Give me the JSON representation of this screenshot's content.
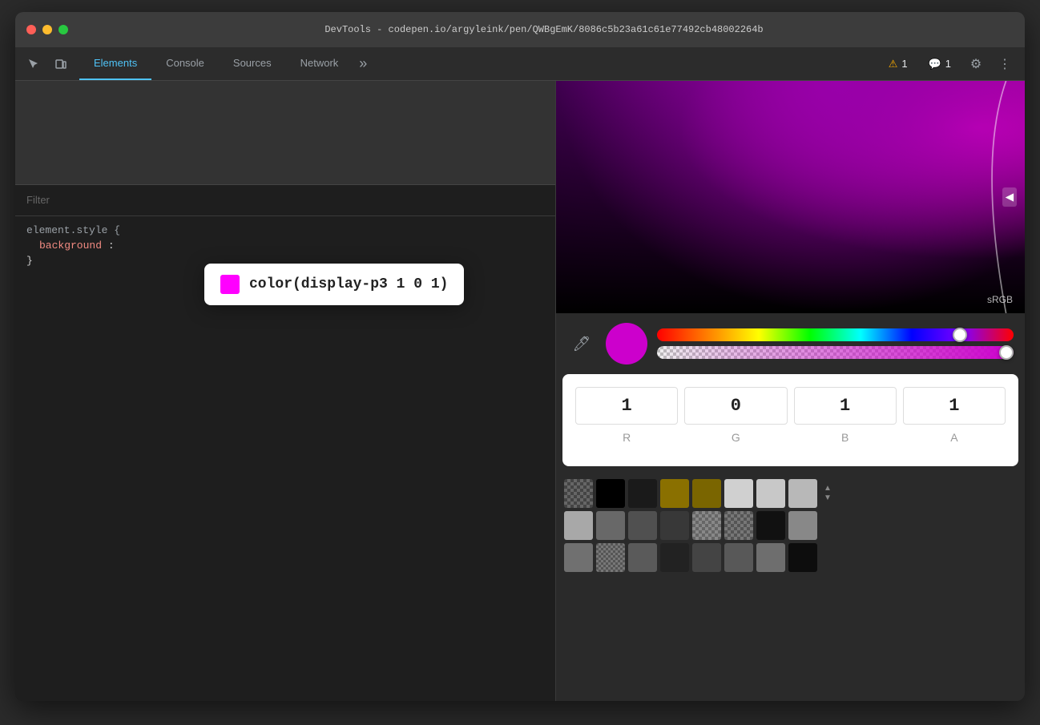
{
  "window": {
    "title": "DevTools - codepen.io/argyleink/pen/QWBgEmK/8086c5b23a61c61e77492cb48002264b"
  },
  "tabs": [
    {
      "label": "Elements",
      "active": true
    },
    {
      "label": "Console",
      "active": false
    },
    {
      "label": "Sources",
      "active": false
    },
    {
      "label": "Network",
      "active": false
    }
  ],
  "toolbar": {
    "more_icon": "»",
    "warn_count": "1",
    "info_count": "1",
    "settings_icon": "⚙",
    "more_vert_icon": "⋮"
  },
  "filter": {
    "placeholder": "Filter",
    "label": "Filter"
  },
  "styles": {
    "rule_selector": "element.style {",
    "prop_name": "background",
    "prop_value": "color(display-p3 1 0 1);",
    "close_brace": "}"
  },
  "tooltip": {
    "color_hex": "#ff00ff",
    "text": "color(display-p3 1 0 1)"
  },
  "color_picker": {
    "srgb_label": "sRGB",
    "channel_r": "1",
    "channel_g": "0",
    "channel_b": "1",
    "channel_a": "1",
    "label_r": "R",
    "label_g": "G",
    "label_b": "B",
    "label_a": "A"
  },
  "swatches": {
    "row1": [
      {
        "bg": "repeating-conic-gradient(#666 0% 25%, #444 0% 50%) 0 0/8px 8px",
        "type": "checker"
      },
      {
        "bg": "#000000",
        "type": "solid"
      },
      {
        "bg": "#1a1a1a",
        "type": "solid"
      },
      {
        "bg": "#8a7000",
        "type": "solid"
      },
      {
        "bg": "#7a6500",
        "type": "solid"
      },
      {
        "bg": "#d0d0d0",
        "type": "solid"
      },
      {
        "bg": "#c8c8c8",
        "type": "solid"
      },
      {
        "bg": "#b8b8b8",
        "type": "solid"
      }
    ],
    "row2": [
      {
        "bg": "#a8a8a8",
        "type": "solid"
      },
      {
        "bg": "#686868",
        "type": "solid"
      },
      {
        "bg": "#505050",
        "type": "solid"
      },
      {
        "bg": "#383838",
        "type": "solid"
      },
      {
        "bg": "repeating-conic-gradient(#888 0% 25%, #666 0% 50%) 0 0/8px 8px",
        "type": "checker"
      },
      {
        "bg": "repeating-conic-gradient(#777 0% 25%, #555 0% 50%) 0 0/8px 8px",
        "type": "checker"
      },
      {
        "bg": "#111111",
        "type": "solid"
      },
      {
        "bg": "#888888",
        "type": "solid"
      }
    ],
    "row3": [
      {
        "bg": "#707070",
        "type": "solid"
      },
      {
        "bg": "repeating-conic-gradient(#777 0% 25%, #555 0% 50%) 0 0/6px 6px",
        "type": "checker"
      },
      {
        "bg": "#5a5a5a",
        "type": "solid"
      },
      {
        "bg": "#222222",
        "type": "solid"
      },
      {
        "bg": "#444444",
        "type": "solid"
      },
      {
        "bg": "#585858",
        "type": "solid"
      },
      {
        "bg": "#6e6e6e",
        "type": "solid"
      },
      {
        "bg": "#0d0d0d",
        "type": "solid"
      }
    ]
  }
}
